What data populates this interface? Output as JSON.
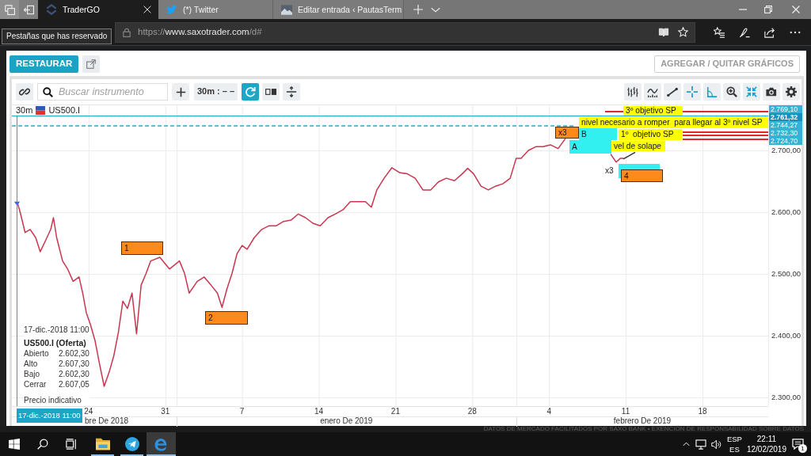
{
  "browser": {
    "tabs": [
      {
        "title": "TraderGO",
        "kind": "logo",
        "selected": true
      },
      {
        "title": "(*) Twitter",
        "kind": "bird",
        "selected": false
      },
      {
        "title": "Editar entrada ‹ PautasTerm",
        "kind": "photo",
        "selected": false
      }
    ],
    "tooltip": "Pestañas que has reservado",
    "address": {
      "scheme": "https://",
      "host": "www.saxotrader.com",
      "path": "/d#"
    }
  },
  "app": {
    "restore_button": "RESTAURAR",
    "charts_button": "AGREGAR / QUITAR GRÁFICOS",
    "toolbar": {
      "search": {
        "placeholder": "Buscar instrumento"
      },
      "interval": "30m : – –",
      "refresh": {
        "on": true
      },
      "tools": [
        {
          "kind": "bars",
          "on": false
        },
        {
          "kind": "indicator",
          "on": false
        },
        {
          "kind": "trendline",
          "on": false
        },
        {
          "kind": "crosshair",
          "on": true
        },
        {
          "kind": "angle",
          "on": true
        },
        {
          "kind": "zoom",
          "on": false
        },
        {
          "kind": "fit",
          "on": true
        },
        {
          "kind": "camera",
          "on": false
        },
        {
          "kind": "settings",
          "on": false
        }
      ]
    },
    "chart": {
      "header": {
        "interval": "30m"
      },
      "legend": {
        "time": "17-dic.-2018 11:00",
        "title": "US500.I (Oferta)",
        "rows": [
          {
            "label": "Abierto",
            "value": "2.602,30"
          },
          {
            "label": "Alto",
            "value": "2.607,30"
          },
          {
            "label": "Bajo",
            "value": "2.602,30"
          },
          {
            "label": "Cerrar",
            "value": "2.607,05"
          }
        ],
        "note": "Precio indicativo"
      },
      "price_tags": [
        {
          "text": "2.769,10",
          "kind": "level"
        },
        {
          "text": "2.761,32",
          "kind": "cursor"
        },
        {
          "text": "2.744,27",
          "kind": "level"
        },
        {
          "text": "2.732,30",
          "kind": "level"
        },
        {
          "text": "2.724,70",
          "kind": "level"
        }
      ],
      "months": [
        "bre De 2018",
        "enero De 2019",
        "febrero De 2019"
      ],
      "drawings": [
        {
          "kind": "crosshair",
          "label": "17-dic.-2018 11:00",
          "color": "#1ba6c4"
        },
        {
          "kind": "line",
          "color": "#56c3e6",
          "dashed": true
        },
        {
          "kind": "line",
          "color": "#e3262b",
          "dashed": false
        },
        {
          "kind": "line",
          "color": "#e3262b",
          "dashed": false
        },
        {
          "kind": "line",
          "color": "#e3262b",
          "dashed": false
        },
        {
          "kind": "line",
          "color": "#e3262b",
          "dashed": false
        },
        {
          "kind": "note",
          "text": "1",
          "color": "#ff8a1c",
          "outlined": true
        },
        {
          "kind": "note",
          "text": "2",
          "color": "#ff8a1c",
          "outlined": true
        },
        {
          "kind": "note",
          "text": "x3",
          "color": "#ff8a1c",
          "outlined": true
        },
        {
          "kind": "note",
          "text": "B",
          "color": "#33f0f0",
          "outlined": false
        },
        {
          "kind": "note",
          "text": "A",
          "color": "#33f0f0",
          "outlined": false
        },
        {
          "kind": "note",
          "text": "3º objetivo SP",
          "color": "#ffff00",
          "outlined": false
        },
        {
          "kind": "note",
          "text": "nivel necesario a romper  para llegar al 3º nivel SP",
          "color": "#ffff00",
          "outlined": false
        },
        {
          "kind": "note",
          "text": "1º  objetivo SP",
          "color": "#ffff00",
          "outlined": false
        },
        {
          "kind": "note",
          "text": "vel de solape",
          "color": "#ffff00",
          "outlined": false
        },
        {
          "kind": "note",
          "color": "#33f0f0",
          "outlined": false
        },
        {
          "kind": "note",
          "text": "4",
          "color": "#ff8a1c",
          "outlined": true
        },
        {
          "kind": "text",
          "text": "x3"
        },
        {
          "kind": "segment",
          "color": "#333333"
        }
      ],
      "chart_data": {
        "type": "line",
        "grid": true,
        "x": [
          "2018-12-17T13:00",
          "2018-12-17T19:00",
          "2018-12-18T05:00",
          "2018-12-18T16:00",
          "2018-12-19T04:00",
          "2018-12-19T14:00",
          "2018-12-20T01:00",
          "2018-12-20T13:00",
          "2018-12-20T19:00",
          "2018-12-21T02:00",
          "2018-12-21T15:00",
          "2018-12-22T02:00",
          "2018-12-22T14:00",
          "2018-12-23T03:00",
          "2018-12-23T11:00",
          "2018-12-23T19:00",
          "2018-12-24T04:00",
          "2018-12-24T14:00",
          "2018-12-25T00:00",
          "2018-12-25T10:00",
          "2018-12-25T21:00",
          "2018-12-26T07:00",
          "2018-12-26T17:00",
          "2018-12-27T03:00",
          "2018-12-27T13:00",
          "2018-12-27T23:00",
          "2018-12-28T09:00",
          "2018-12-28T19:00",
          "2018-12-29T06:00",
          "2018-12-29T16:00",
          "2018-12-30T12:00",
          "2018-12-31T09:00",
          "2019-01-01T07:00",
          "2019-01-01T18:00",
          "2019-01-02T04:00",
          "2019-01-02T22:00",
          "2019-01-03T13:00",
          "2019-01-04T04:00",
          "2019-01-04T18:00",
          "2019-01-05T04:00",
          "2019-01-05T15:00",
          "2019-01-06T02:00",
          "2019-01-06T13:00",
          "2019-01-07T00:00",
          "2019-01-07T11:00",
          "2019-01-08T03:00",
          "2019-01-08T19:00",
          "2019-01-09T11:00",
          "2019-01-10T03:00",
          "2019-01-10T19:00",
          "2019-01-11T11:00",
          "2019-01-12T03:00",
          "2019-01-12T19:00",
          "2019-01-13T11:00",
          "2019-01-14T03:00",
          "2019-01-14T20:00",
          "2019-01-15T12:00",
          "2019-01-16T05:00",
          "2019-01-16T21:00",
          "2019-01-17T14:00",
          "2019-01-18T06:00",
          "2019-01-18T19:00",
          "2019-01-19T07:00",
          "2019-01-19T23:00",
          "2019-01-20T16:00",
          "2019-01-21T09:00",
          "2019-01-22T02:00",
          "2019-01-22T19:00",
          "2019-01-23T12:00",
          "2019-01-24T05:00",
          "2019-01-24T22:00",
          "2019-01-25T15:00",
          "2019-01-26T09:00",
          "2019-01-27T02:00",
          "2019-01-27T14:00",
          "2019-01-28T03:00",
          "2019-01-28T19:00",
          "2019-01-29T11:00",
          "2019-01-30T03:00",
          "2019-01-30T19:00",
          "2019-01-31T11:00",
          "2019-02-01T00:00",
          "2019-02-01T11:00",
          "2019-02-02T03:00",
          "2019-02-02T19:00",
          "2019-02-03T11:00",
          "2019-02-04T03:00",
          "2019-02-04T20:00",
          "2019-02-05T12:00",
          "2019-02-09T15:00",
          "2019-02-10T03:00",
          "2019-02-10T12:00",
          "2019-02-10T19:00"
        ],
        "series": [
          {
            "name": "US500.I",
            "color": "#c8364f",
            "values": [
              2613,
              2597,
              2567,
              2572,
              2559,
              2536,
              2553,
              2572,
              2591,
              2559,
              2521,
              2508,
              2488,
              2495,
              2469,
              2437,
              2418,
              2392,
              2354,
              2318,
              2341,
              2367,
              2405,
              2456,
              2444,
              2469,
              2403,
              2482,
              2501,
              2521,
              2527,
              2508,
              2521,
              2501,
              2469,
              2488,
              2495,
              2482,
              2469,
              2446,
              2476,
              2501,
              2533,
              2546,
              2540,
              2559,
              2572,
              2578,
              2578,
              2585,
              2587,
              2597,
              2591,
              2582,
              2578,
              2591,
              2597,
              2604,
              2617,
              2617,
              2617,
              2608,
              2636,
              2655,
              2672,
              2664,
              2662,
              2655,
              2636,
              2636,
              2649,
              2655,
              2651,
              2662,
              2671,
              2662,
              2642,
              2636,
              2642,
              2646,
              2655,
              2687,
              2687,
              2700,
              2706,
              2706,
              2709,
              2703,
              2719,
              2694,
              2681,
              2687,
              2687
            ]
          }
        ],
        "xlim": [
          "2018-12-17T00:00",
          "2019-02-24T00:00"
        ],
        "ylim": [
          2286,
          2773
        ],
        "xticks": [
          {
            "value": "2018-12-24",
            "label": "24"
          },
          {
            "value": "2018-12-31",
            "label": "31"
          },
          {
            "value": "2019-01-07",
            "label": "7"
          },
          {
            "value": "2019-01-14",
            "label": "14"
          },
          {
            "value": "2019-01-21",
            "label": "21"
          },
          {
            "value": "2019-01-28",
            "label": "28"
          },
          {
            "value": "2019-02-04",
            "label": "4"
          },
          {
            "value": "2019-02-11",
            "label": "11"
          },
          {
            "value": "2019-02-18",
            "label": "18"
          }
        ],
        "yticks": [
          {
            "value": 2300,
            "label": "2.300,00"
          },
          {
            "value": 2400,
            "label": "2.400,00"
          },
          {
            "value": 2500,
            "label": "2.500,00"
          },
          {
            "value": 2600,
            "label": "2.600,00"
          },
          {
            "value": 2700,
            "label": "2.700,00"
          }
        ]
      }
    }
  },
  "disclaimer": "DATOS DE MERCADO FACILITADOS POR SAXO BANK • EXENCIÓN DE RESPONSABILIDAD SOBRE DATOS",
  "taskbar": {
    "apps": [
      {
        "kind": "folder",
        "open": true,
        "selected": false
      },
      {
        "kind": "plane",
        "open": true,
        "selected": false
      },
      {
        "kind": "browser",
        "open": true,
        "selected": true
      }
    ],
    "language": "ESP",
    "layout": "ES",
    "time": "22:11",
    "date": "12/02/2019",
    "notifications": "1"
  }
}
